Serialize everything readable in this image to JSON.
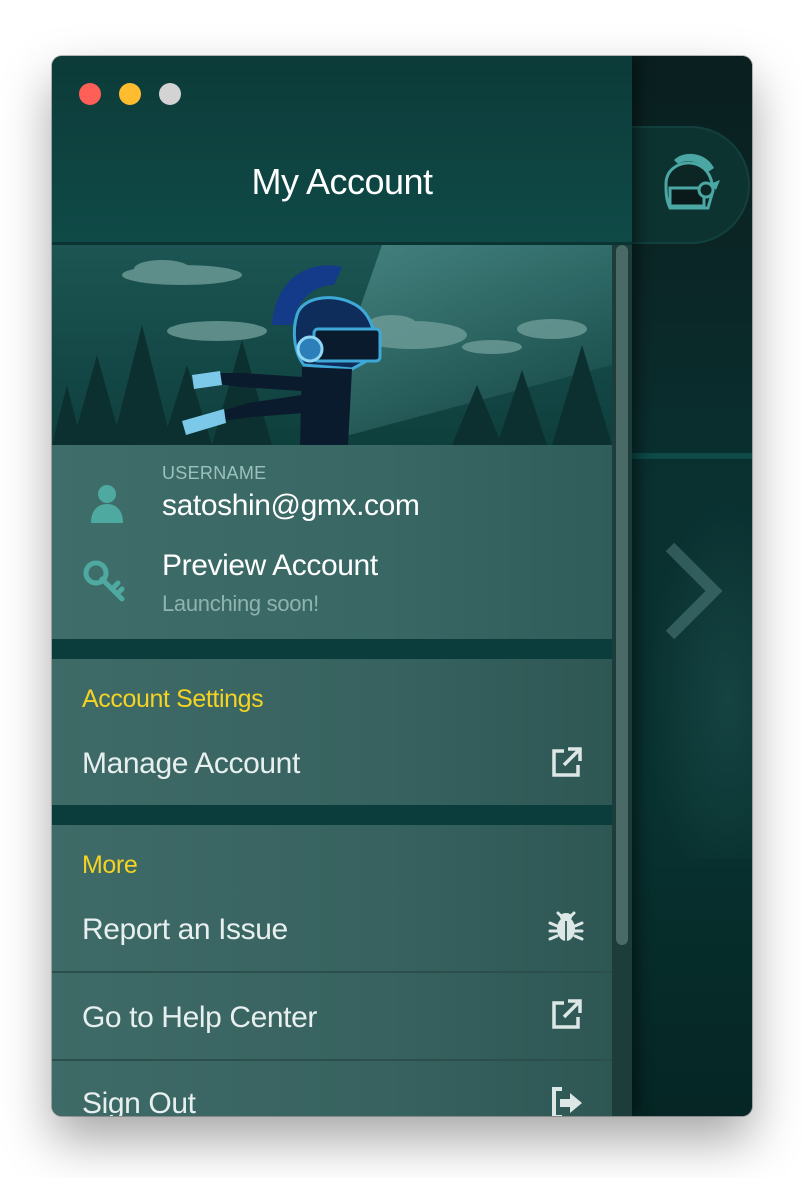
{
  "window": {
    "title": "My Account"
  },
  "account": {
    "username_label": "USERNAME",
    "username": "satoshin@gmx.com",
    "plan": "Preview Account",
    "plan_note": "Launching soon!"
  },
  "sections": {
    "account_settings": {
      "heading": "Account Settings",
      "manage_account": "Manage Account"
    },
    "more": {
      "heading": "More",
      "report_issue": "Report an Issue",
      "help_center": "Go to Help Center",
      "sign_out": "Sign Out"
    }
  },
  "icons": {
    "close": "red-traffic-light",
    "minimize": "yellow-traffic-light",
    "zoom": "gray-traffic-light",
    "avatar": "helmet-icon",
    "user": "user-icon",
    "key": "key-icon",
    "external_link": "external-link-icon",
    "bug": "bug-icon",
    "sign_out": "sign-out-icon",
    "next": "chevron-right-icon"
  },
  "colors": {
    "accent_yellow": "#f5d324",
    "drawer_bg": "#0a4240",
    "section_bg": "#3e6a67"
  }
}
